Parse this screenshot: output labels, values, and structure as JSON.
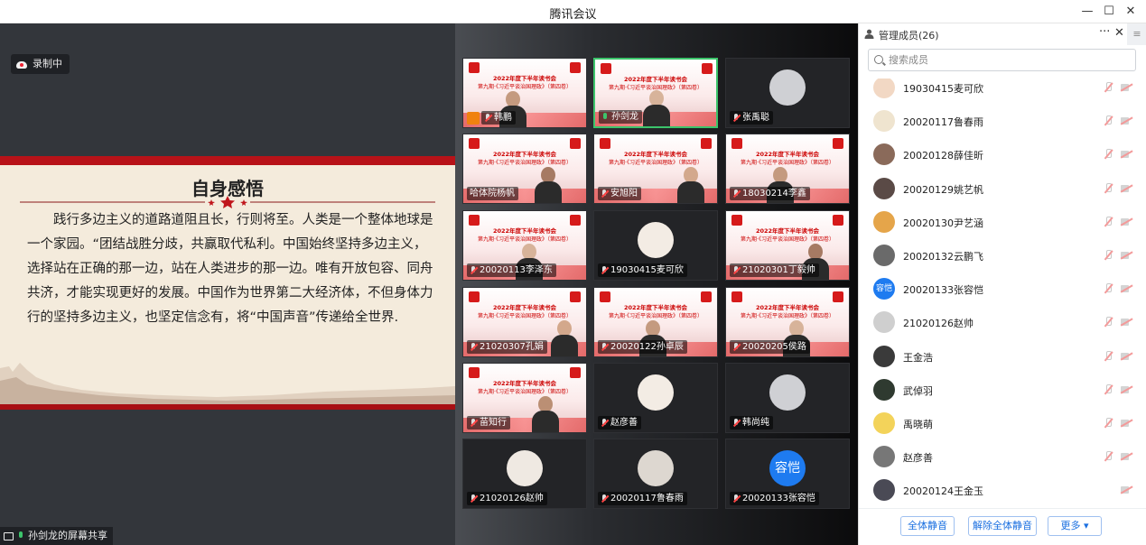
{
  "window": {
    "title": "腾讯会议",
    "controls": [
      "minimize",
      "maximize",
      "close"
    ]
  },
  "share": {
    "recording_label": "录制中",
    "sharer_label": "孙剑龙的屏幕共享",
    "slide": {
      "heading": "自身感悟",
      "body": "践行多边主义的道路道阻且长，行则将至。人类是一个整体地球是一个家园。“团结战胜分歧，共赢取代私利。中国始终坚持多边主义，选择站在正确的那一边，站在人类进步的那一边。唯有开放包容、同舟共济，才能实现更好的发展。中国作为世界第二大经济体，不但身体力行的坚持多边主义，也坚定信念有，将“中国声音”传递给全世界."
    }
  },
  "poster": {
    "title": "2022年度下半年读书会",
    "subtitle": "第九期·《习近平谈治国理政》（第四卷）"
  },
  "tiles": [
    {
      "name": "韩鹏",
      "kind": "poster",
      "mic": "off"
    },
    {
      "name": "孙剑龙",
      "kind": "poster",
      "mic": "on",
      "active": true
    },
    {
      "name": "张禹聪",
      "kind": "avatar",
      "mic": "off"
    },
    {
      "name": "哈体院杨帆",
      "kind": "poster",
      "mic": "none"
    },
    {
      "name": "安旭阳",
      "kind": "poster",
      "mic": "off"
    },
    {
      "name": "18030214李鑫",
      "kind": "poster",
      "mic": "off"
    },
    {
      "name": "20020113李泽东",
      "kind": "poster",
      "mic": "off"
    },
    {
      "name": "19030415麦可欣",
      "kind": "avatar",
      "mic": "off"
    },
    {
      "name": "21020301丁毅帅",
      "kind": "poster",
      "mic": "off"
    },
    {
      "name": "21020307孔娟",
      "kind": "poster",
      "mic": "off"
    },
    {
      "name": "20020122孙卓辰",
      "kind": "poster",
      "mic": "off"
    },
    {
      "name": "20020205侯路",
      "kind": "poster",
      "mic": "off"
    },
    {
      "name": "苗知行",
      "kind": "poster",
      "mic": "off"
    },
    {
      "name": "赵彦善",
      "kind": "avatar",
      "mic": "off"
    },
    {
      "name": "韩尚纯",
      "kind": "avatar",
      "mic": "off"
    },
    {
      "name": "21020126赵帅",
      "kind": "avatar",
      "mic": "off"
    },
    {
      "name": "20020117鲁春雨",
      "kind": "avatar",
      "mic": "off"
    },
    {
      "name": "20020133张容恺",
      "kind": "avatar-text",
      "avatar_text": "容恺",
      "mic": "off"
    }
  ],
  "panel": {
    "title": "管理成员(26)",
    "more_label": "···",
    "close_label": "✕",
    "side_label": "≡",
    "search_placeholder": "搜索成员",
    "members": [
      {
        "name": "19030415麦可欣",
        "avatar_color": "#f2d8c4"
      },
      {
        "name": "20020117鲁春雨",
        "avatar_color": "#efe4cf"
      },
      {
        "name": "20020128薛佳昕",
        "avatar_color": "#8a6a5a"
      },
      {
        "name": "20020129姚艺帆",
        "avatar_color": "#5a4a46"
      },
      {
        "name": "20020130尹艺涵",
        "avatar_color": "#e5a54a"
      },
      {
        "name": "20020132云鹏飞",
        "avatar_color": "#6a6a6a"
      },
      {
        "name": "20020133张容恺",
        "avatar_color": "#1e7bf0",
        "avatar_text": "容恺"
      },
      {
        "name": "21020126赵帅",
        "avatar_color": "#cfcfcf"
      },
      {
        "name": "王金浩",
        "avatar_color": "#3a3a3a"
      },
      {
        "name": "武倬羽",
        "avatar_color": "#2f3a30"
      },
      {
        "name": "禹晓萌",
        "avatar_color": "#f3d35a"
      },
      {
        "name": "赵彦善",
        "avatar_color": "#777777"
      },
      {
        "name": "20020124王金玉",
        "avatar_color": "#4a4a55",
        "mic_hidden": true
      }
    ],
    "buttons": {
      "mute_all": "全体静音",
      "unmute_all": "解除全体静音",
      "more": "更多 ▾"
    }
  },
  "colors": {
    "accent_blue": "#1e7bf0",
    "active_green": "#3cc46b",
    "slide_red": "#b81218"
  }
}
